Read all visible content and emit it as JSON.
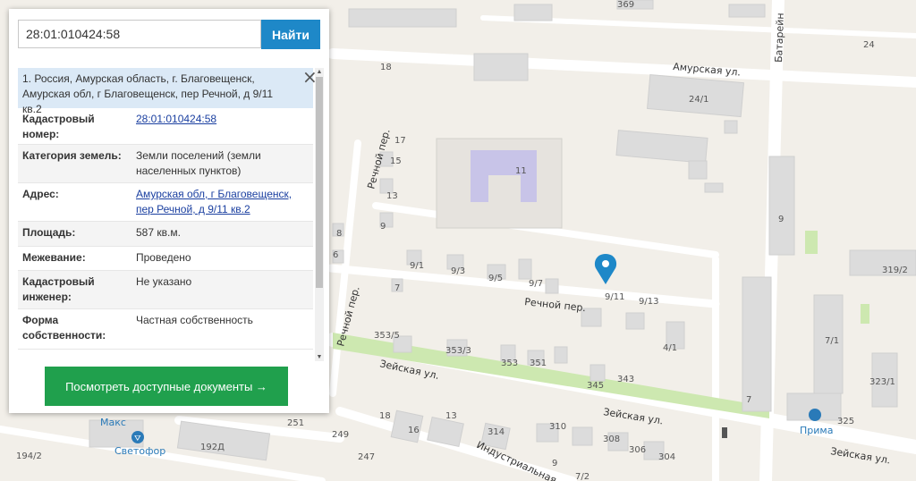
{
  "search": {
    "value": "28:01:010424:58",
    "button_label": "Найти"
  },
  "result": {
    "address_header": "1. Россия, Амурская область, г. Благовещенск, Амурская обл, г Благовещенск, пер Речной, д 9/11 кв.2",
    "close_symbol": "×",
    "rows": [
      {
        "key": "Кадастровый номер:",
        "value": "28:01:010424:58"
      },
      {
        "key": "Категория земель:",
        "value": "Земли поселений (земли населенных пунктов)"
      },
      {
        "key": "Адрес:",
        "value": "Амурская обл, г Благовещенск, пер Речной, д 9/11 кв.2"
      },
      {
        "key": "Площадь:",
        "value": "587 кв.м."
      },
      {
        "key": "Межевание:",
        "value": "Проведено"
      },
      {
        "key": "Кадастровый инженер:",
        "value": "Не указано"
      },
      {
        "key": "Форма собственности:",
        "value": "Частная собственность"
      }
    ],
    "docs_button_label": "Посмотреть доступные документы →"
  },
  "map": {
    "streets": {
      "amurskaya": "Амурская ул.",
      "rechnoy_vertical": "Речной пер.",
      "rechnoy_lower": "Речной пер.",
      "rechnoy_main": "Речной пер.",
      "zeyskaya_left": "Зейская ул.",
      "zeyskaya_mid": "Зейская ул.",
      "zeyskaya_right": "Зейская ул.",
      "batareynaya": "Батарейн",
      "industrialnaya": "Индустриальная"
    },
    "house_numbers": [
      "369",
      "24",
      "18",
      "24/1",
      "17",
      "15",
      "11",
      "13",
      "9",
      "8",
      "6",
      "9/1",
      "9/3",
      "9/5",
      "9/7",
      "7",
      "9/11",
      "9/13",
      "9",
      "319/2",
      "353/5",
      "353/3",
      "353",
      "351",
      "345",
      "343",
      "4/1",
      "7/1",
      "323/1",
      "7",
      "325",
      "18",
      "13",
      "251",
      "249",
      "16",
      "314",
      "310",
      "308",
      "306",
      "304",
      "247",
      "192Д",
      "194/2",
      "9",
      "7/2"
    ],
    "pois": {
      "maks": "Макс",
      "svetofor": "Светофор",
      "prima": "Прима"
    },
    "colors": {
      "road": "#ffffff",
      "green": "#cde8b0",
      "building": "#dcdcdc",
      "school": "#c8c4e8",
      "pin": "#1e88c8"
    }
  }
}
